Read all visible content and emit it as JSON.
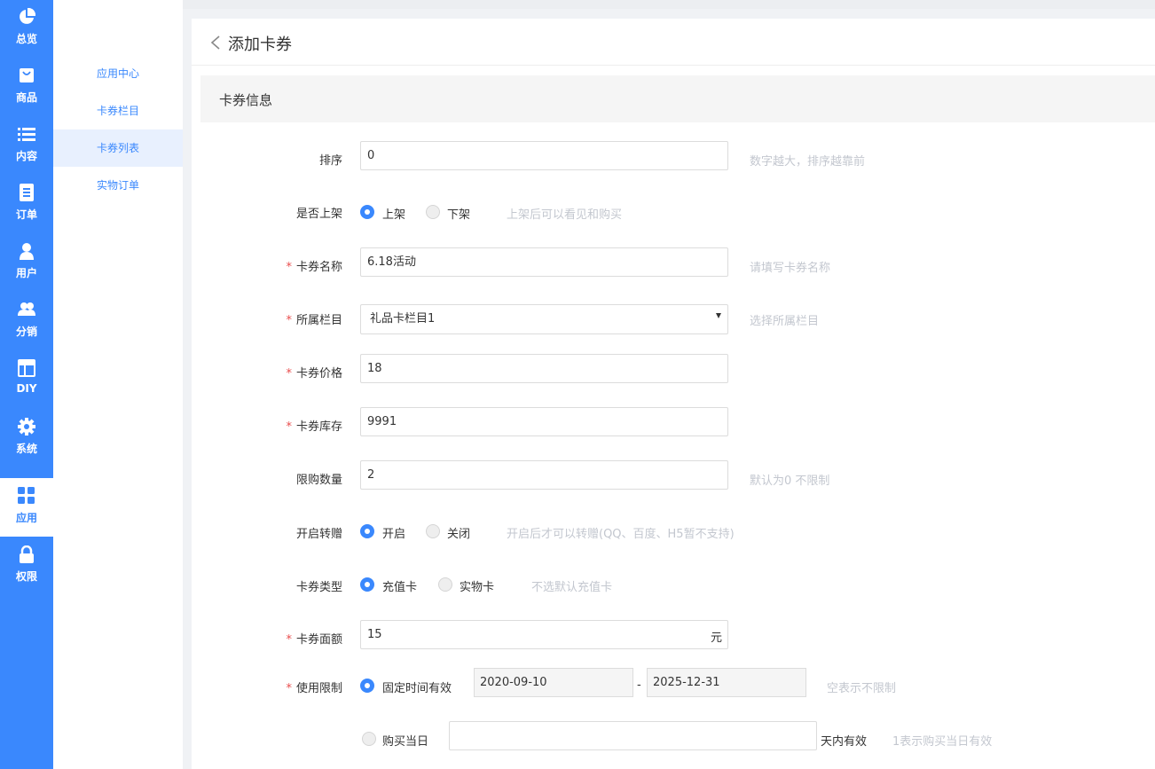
{
  "nav": {
    "items": [
      {
        "label": "总览",
        "icon": "pie-chart-icon"
      },
      {
        "label": "商品",
        "icon": "shopping-bag-icon"
      },
      {
        "label": "内容",
        "icon": "list-icon"
      },
      {
        "label": "订单",
        "icon": "document-icon"
      },
      {
        "label": "用户",
        "icon": "user-icon"
      },
      {
        "label": "分销",
        "icon": "users-icon"
      },
      {
        "label": "DIY",
        "icon": "layout-icon"
      },
      {
        "label": "系统",
        "icon": "gear-icon"
      },
      {
        "label": "应用",
        "icon": "grid-icon"
      },
      {
        "label": "权限",
        "icon": "lock-icon"
      }
    ],
    "active": "应用",
    "accent_color": "#3a88fd"
  },
  "subnav": {
    "items": [
      "应用中心",
      "卡券栏目",
      "卡券列表",
      "实物订单"
    ],
    "active": "卡券列表"
  },
  "page": {
    "title": "添加卡券",
    "section_title": "卡券信息"
  },
  "form": {
    "sort": {
      "label": "排序",
      "value": "0",
      "hint": "数字越大，排序越靠前"
    },
    "listed": {
      "label": "是否上架",
      "options": [
        "上架",
        "下架"
      ],
      "selected": "上架",
      "hint": "上架后可以看见和购买"
    },
    "name": {
      "label": "卡券名称",
      "required_mark": "*",
      "value": "6.18活动",
      "hint": "请填写卡券名称"
    },
    "category": {
      "label": "所属栏目",
      "required_mark": "*",
      "value": "礼品卡栏目1",
      "hint": "选择所属栏目"
    },
    "price": {
      "label": "卡券价格",
      "required_mark": "*",
      "value": "18"
    },
    "stock": {
      "label": "卡券库存",
      "required_mark": "*",
      "value": "9991"
    },
    "limit": {
      "label": "限购数量",
      "value": "2",
      "hint": "默认为0 不限制"
    },
    "transfer": {
      "label": "开启转赠",
      "options": [
        "开启",
        "关闭"
      ],
      "selected": "开启",
      "hint": "开启后才可以转赠(QQ、百度、H5暂不支持)"
    },
    "type": {
      "label": "卡券类型",
      "options": [
        "充值卡",
        "实物卡"
      ],
      "selected": "充值卡",
      "hint": "不选默认充值卡"
    },
    "face_value": {
      "label": "卡券面额",
      "required_mark": "*",
      "value": "15",
      "unit": "元"
    },
    "usage": {
      "label": "使用限制",
      "required_mark": "*",
      "fixed_label": "固定时间有效",
      "fixed_selected": true,
      "start_date": "2020-09-10",
      "separator": "-",
      "end_date": "2025-12-31",
      "fixed_hint": "空表示不限制",
      "purchase_label": "购买当日",
      "purchase_value": "",
      "purchase_suffix": "天内有效",
      "purchase_hint": "1表示购买当日有效"
    }
  }
}
